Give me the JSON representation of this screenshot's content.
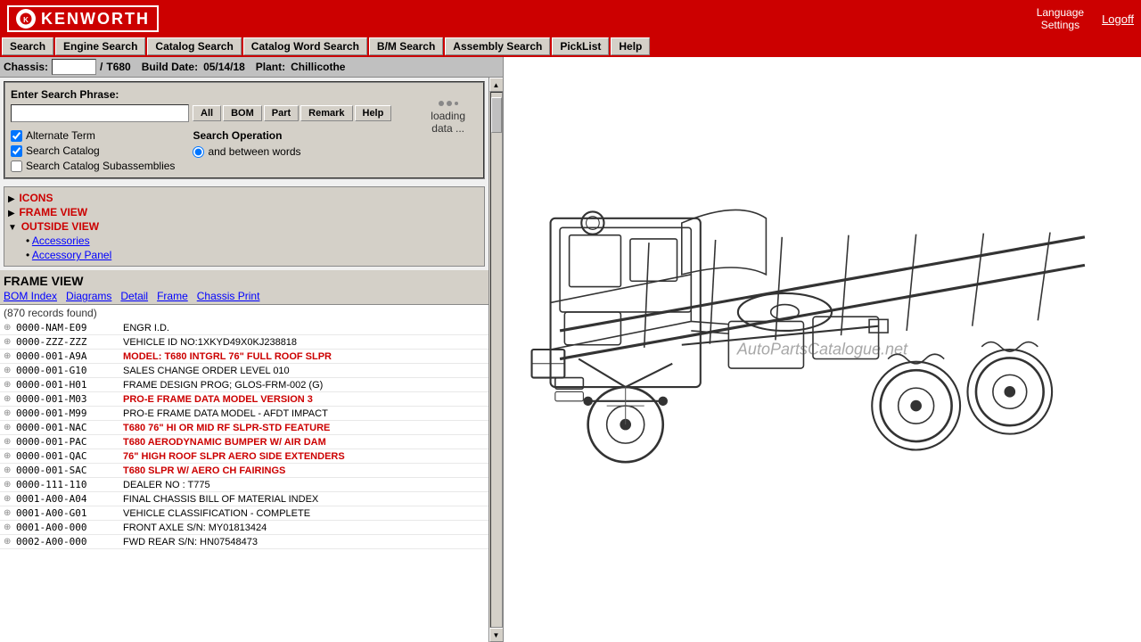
{
  "header": {
    "logo_text": "KENWORTH",
    "language_settings": "Language\nSettings",
    "logoff": "Logoff"
  },
  "navbar": {
    "items": [
      {
        "id": "search",
        "label": "Search"
      },
      {
        "id": "engine-search",
        "label": "Engine Search"
      },
      {
        "id": "catalog-search",
        "label": "Catalog Search"
      },
      {
        "id": "catalog-word-search",
        "label": "Catalog Word Search"
      },
      {
        "id": "bm-search",
        "label": "B/M Search"
      },
      {
        "id": "assembly-search",
        "label": "Assembly Search"
      },
      {
        "id": "picklist",
        "label": "PickList"
      },
      {
        "id": "help",
        "label": "Help"
      }
    ]
  },
  "chassis_bar": {
    "label": "Chassis:",
    "value": "",
    "separator": "/",
    "model": "T680",
    "build_date_label": "Build Date:",
    "build_date": "05/14/18",
    "plant_label": "Plant:",
    "plant": "Chillicothe"
  },
  "search_area": {
    "phrase_label": "Enter Search Phrase:",
    "input_value": "",
    "input_placeholder": "",
    "buttons": [
      {
        "id": "all-btn",
        "label": "All"
      },
      {
        "id": "bom-btn",
        "label": "BOM"
      },
      {
        "id": "part-btn",
        "label": "Part"
      },
      {
        "id": "remark-btn",
        "label": "Remark"
      },
      {
        "id": "help-btn",
        "label": "Help"
      }
    ],
    "checkboxes": [
      {
        "id": "alternate-term",
        "label": "Alternate Term",
        "checked": true
      },
      {
        "id": "search-catalog",
        "label": "Search Catalog",
        "checked": true
      },
      {
        "id": "search-subassemblies",
        "label": "Search Catalog Subassemblies",
        "checked": false
      }
    ],
    "search_operation": {
      "title": "Search Operation",
      "options": [
        {
          "id": "and-between",
          "label": "and between words",
          "selected": true
        }
      ]
    },
    "loading_text": "loading\ndata ..."
  },
  "tree": {
    "items": [
      {
        "id": "icons",
        "label": "ICONS",
        "level": 0,
        "arrow": "▶"
      },
      {
        "id": "frame-view",
        "label": "FRAME VIEW",
        "level": 0,
        "arrow": "▶"
      },
      {
        "id": "outside-view",
        "label": "OUTSIDE VIEW",
        "level": 0,
        "arrow": "▼"
      },
      {
        "id": "accessories",
        "label": "Accessories",
        "level": 1
      },
      {
        "id": "accessory-panel",
        "label": "Accessory Panel",
        "level": 1
      }
    ]
  },
  "frame_section": {
    "title": "FRAME VIEW",
    "links": [
      {
        "id": "bom-index",
        "label": "BOM Index"
      },
      {
        "id": "diagrams",
        "label": "Diagrams"
      },
      {
        "id": "detail",
        "label": "Detail"
      },
      {
        "id": "frame",
        "label": "Frame"
      },
      {
        "id": "chassis-print",
        "label": "Chassis Print"
      }
    ],
    "record_count": "(870 records found)"
  },
  "parts": [
    {
      "expand": "⊕",
      "num": "0000-NAM-E09",
      "desc": "ENGR I.D.",
      "highlight": false
    },
    {
      "expand": "⊕",
      "num": "0000-ZZZ-ZZZ",
      "desc": "VEHICLE ID NO:1XKYD49X0KJ238818",
      "highlight": false
    },
    {
      "expand": "⊕",
      "num": "0000-001-A9A",
      "desc": "MODEL: T680 INTGRL 76\" FULL ROOF SLPR",
      "highlight": true
    },
    {
      "expand": "⊕",
      "num": "0000-001-G10",
      "desc": "SALES CHANGE ORDER LEVEL 010",
      "highlight": false
    },
    {
      "expand": "⊕",
      "num": "0000-001-H01",
      "desc": "FRAME DESIGN PROG; GLOS-FRM-002 (G)",
      "highlight": false
    },
    {
      "expand": "⊕",
      "num": "0000-001-M03",
      "desc": "PRO-E FRAME DATA MODEL VERSION 3",
      "highlight": true
    },
    {
      "expand": "⊕",
      "num": "0000-001-M99",
      "desc": "PRO-E FRAME DATA MODEL - AFDT IMPACT",
      "highlight": false
    },
    {
      "expand": "⊕",
      "num": "0000-001-NAC",
      "desc": "T680 76\" HI OR MID RF SLPR-STD FEATURE",
      "highlight": true
    },
    {
      "expand": "⊕",
      "num": "0000-001-PAC",
      "desc": "T680 AERODYNAMIC BUMPER W/ AIR DAM",
      "highlight": true
    },
    {
      "expand": "⊕",
      "num": "0000-001-QAC",
      "desc": "76\" HIGH ROOF SLPR AERO SIDE EXTENDERS",
      "highlight": true
    },
    {
      "expand": "⊕",
      "num": "0000-001-SAC",
      "desc": "T680 SLPR W/ AERO CH FAIRINGS",
      "highlight": true
    },
    {
      "expand": "⊕",
      "num": "0000-111-110",
      "desc": "DEALER NO : T775",
      "highlight": false
    },
    {
      "expand": "⊕",
      "num": "0001-A00-A04",
      "desc": "FINAL CHASSIS BILL OF MATERIAL INDEX",
      "highlight": false
    },
    {
      "expand": "⊕",
      "num": "0001-A00-G01",
      "desc": "VEHICLE CLASSIFICATION - COMPLETE",
      "highlight": false
    },
    {
      "expand": "⊕",
      "num": "0001-A00-000",
      "desc": "FRONT AXLE S/N: MY01813424",
      "highlight": false
    },
    {
      "expand": "⊕",
      "num": "0002-A00-000",
      "desc": "FWD REAR S/N: HN07548473",
      "highlight": false
    }
  ],
  "watermark": "AutoPartsCatalogue.net"
}
